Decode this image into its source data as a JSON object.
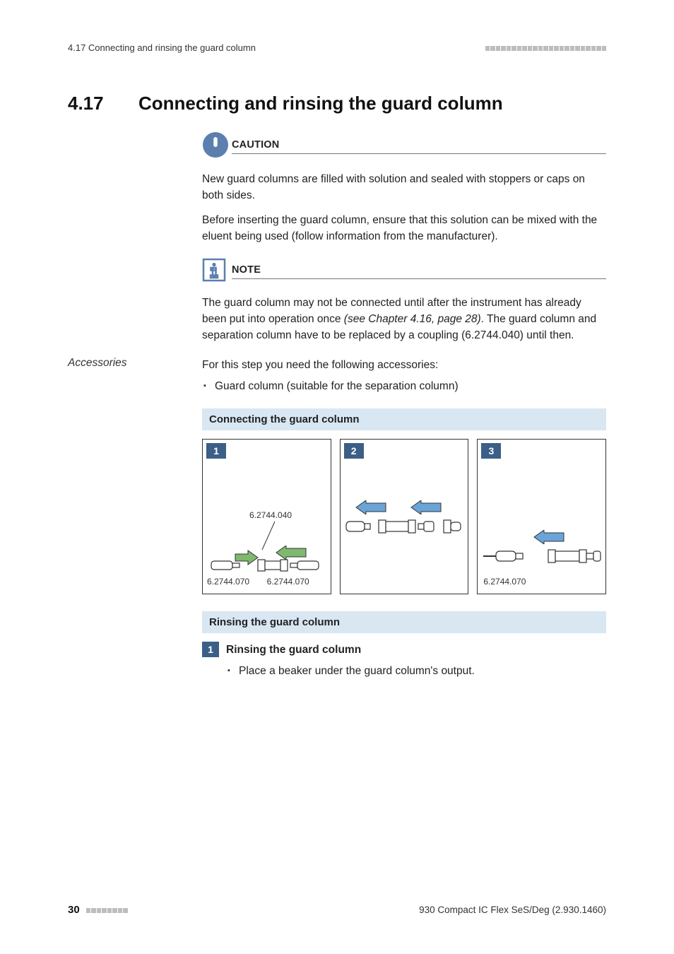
{
  "running_header": {
    "left": "4.17 Connecting and rinsing the guard column"
  },
  "heading": {
    "number": "4.17",
    "title": "Connecting and rinsing the guard column"
  },
  "caution": {
    "label": "CAUTION",
    "p1": "New guard columns are filled with solution and sealed with stoppers or caps on both sides.",
    "p2": "Before inserting the guard column, ensure that this solution can be mixed with the eluent being used (follow information from the manufacturer)."
  },
  "note": {
    "label": "NOTE",
    "p1_a": "The guard column may not be connected until after the instrument has already been put into operation once ",
    "p1_ref": "(see Chapter 4.16, page 28)",
    "p1_b": ". The guard column and separation column have to be replaced by a coupling (6.2744.040) until then."
  },
  "accessories": {
    "label": "Accessories",
    "intro": "For this step you need the following accessories:",
    "items": [
      "Guard column (suitable for the separation column)"
    ]
  },
  "subhead_connect": "Connecting the guard column",
  "diagrams": {
    "d1": {
      "num": "1",
      "label_top": "6.2744.040",
      "label_bl": "6.2744.070",
      "label_br": "6.2744.070"
    },
    "d2": {
      "num": "2"
    },
    "d3": {
      "num": "3",
      "label_bl": "6.2744.070"
    }
  },
  "subhead_rinse": "Rinsing the guard column",
  "step1": {
    "num": "1",
    "title": "Rinsing the guard column",
    "items": [
      "Place a beaker under the guard column's output."
    ]
  },
  "footer": {
    "pagenum": "30",
    "doc": "930 Compact IC Flex SeS/Deg (2.930.1460)"
  }
}
